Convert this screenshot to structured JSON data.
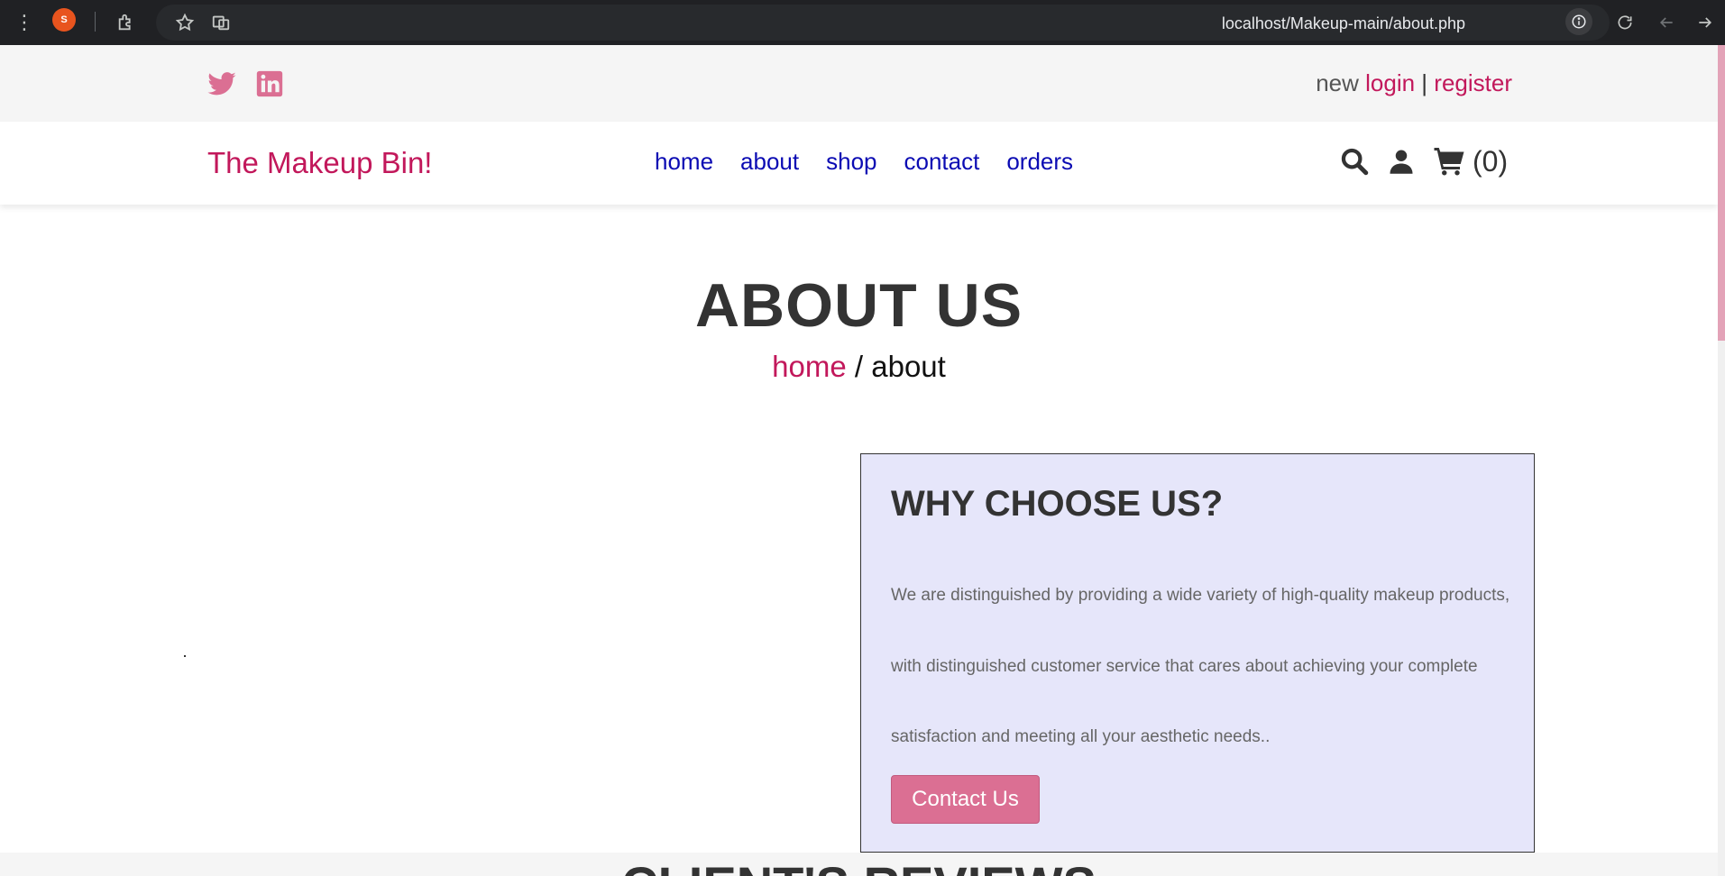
{
  "browser": {
    "profile_letter": "S",
    "url": "localhost/Makeup-main/about.php"
  },
  "topbar": {
    "new_label": "new",
    "login_label": "login",
    "separator": "|",
    "register_label": "register"
  },
  "navbar": {
    "logo": "The Makeup Bin!",
    "menu": [
      "home",
      "about",
      "shop",
      "contact",
      "orders"
    ],
    "cart_count": "(0)"
  },
  "heading": {
    "title": "ABOUT US",
    "breadcrumb_home": "home",
    "breadcrumb_sep": " / ",
    "breadcrumb_current": "about"
  },
  "about_box": {
    "title": "WHY CHOOSE US?",
    "text": "We are distinguished by providing a wide variety of high-quality makeup products, with distinguished customer service that cares about achieving your complete satisfaction and meeting all your aesthetic needs..",
    "button": "Contact Us"
  },
  "reviews": {
    "title": "CLIENT'S REVIEWS"
  },
  "colors": {
    "accent": "#c2185b",
    "button": "#db6f93",
    "nav_link": "#0b0bb3",
    "box_bg": "#e6e6fa"
  }
}
